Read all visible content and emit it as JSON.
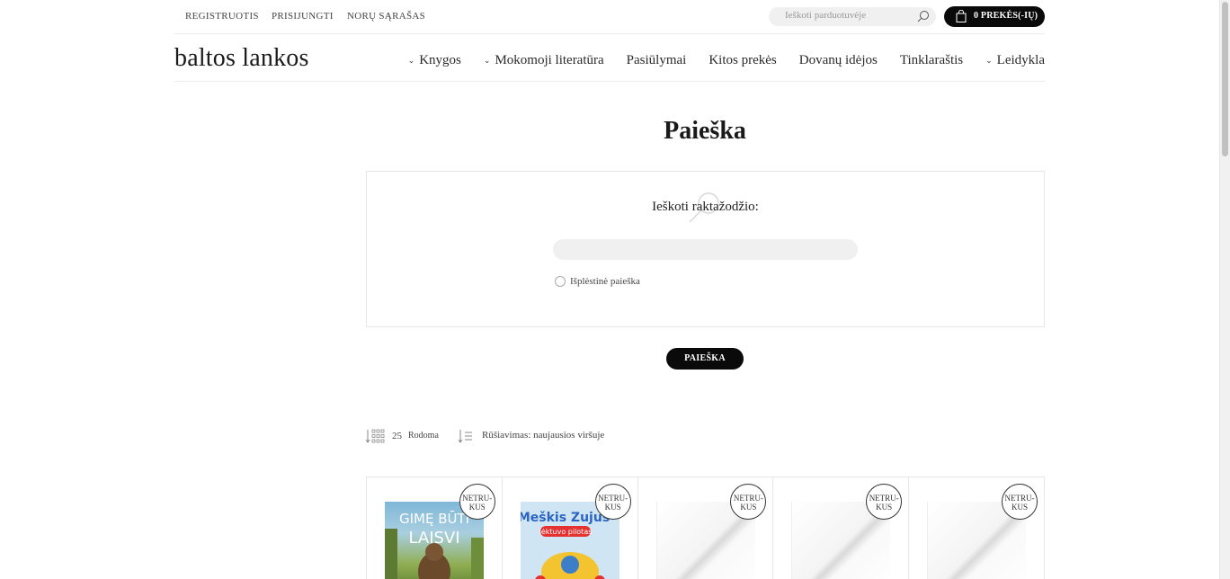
{
  "topbar": {
    "register": "REGISTRUOTIS",
    "login": "PRISIJUNGTI",
    "wishlist": "NORŲ SĄRAŠAS",
    "search_placeholder": "Ieškoti parduotuvėje",
    "cart_label": "0 PREKĖS(-IŲ)"
  },
  "header": {
    "logo": "baltos lankos",
    "nav": [
      {
        "label": "Knygos",
        "dropdown": true
      },
      {
        "label": "Mokomoji literatūra",
        "dropdown": true
      },
      {
        "label": "Pasiūlymai",
        "dropdown": false
      },
      {
        "label": "Kitos prekės",
        "dropdown": false
      },
      {
        "label": "Dovanų idėjos",
        "dropdown": false
      },
      {
        "label": "Tinklaraštis",
        "dropdown": false
      },
      {
        "label": "Leidykla",
        "dropdown": true
      }
    ]
  },
  "main": {
    "title": "Paieška",
    "search_label": "Ieškoti raktažodžio:",
    "search_value": "",
    "advanced_label": "Išplėstinė paieška",
    "search_button": "PAIEŠKA"
  },
  "toolbar": {
    "count": "25",
    "shown_label": "Rodoma",
    "sort_label": "Rūšiavimas: naujausios viršuje"
  },
  "products": [
    {
      "badge_line1": "NETRU-",
      "badge_line2": "KUS",
      "cover": "book-cover-gime-buti-laisvi"
    },
    {
      "badge_line1": "NETRU-",
      "badge_line2": "KUS",
      "cover": "book-cover-meskis-zujus"
    },
    {
      "badge_line1": "NETRU-",
      "badge_line2": "KUS",
      "cover": "placeholder-cover"
    },
    {
      "badge_line1": "NETRU-",
      "badge_line2": "KUS",
      "cover": "placeholder-cover"
    },
    {
      "badge_line1": "NETRU-",
      "badge_line2": "KUS",
      "cover": "placeholder-cover"
    }
  ],
  "colors": {
    "accent": "#0a0a0a",
    "field_bg": "#f0f0f0",
    "border": "#e6e6e6"
  }
}
